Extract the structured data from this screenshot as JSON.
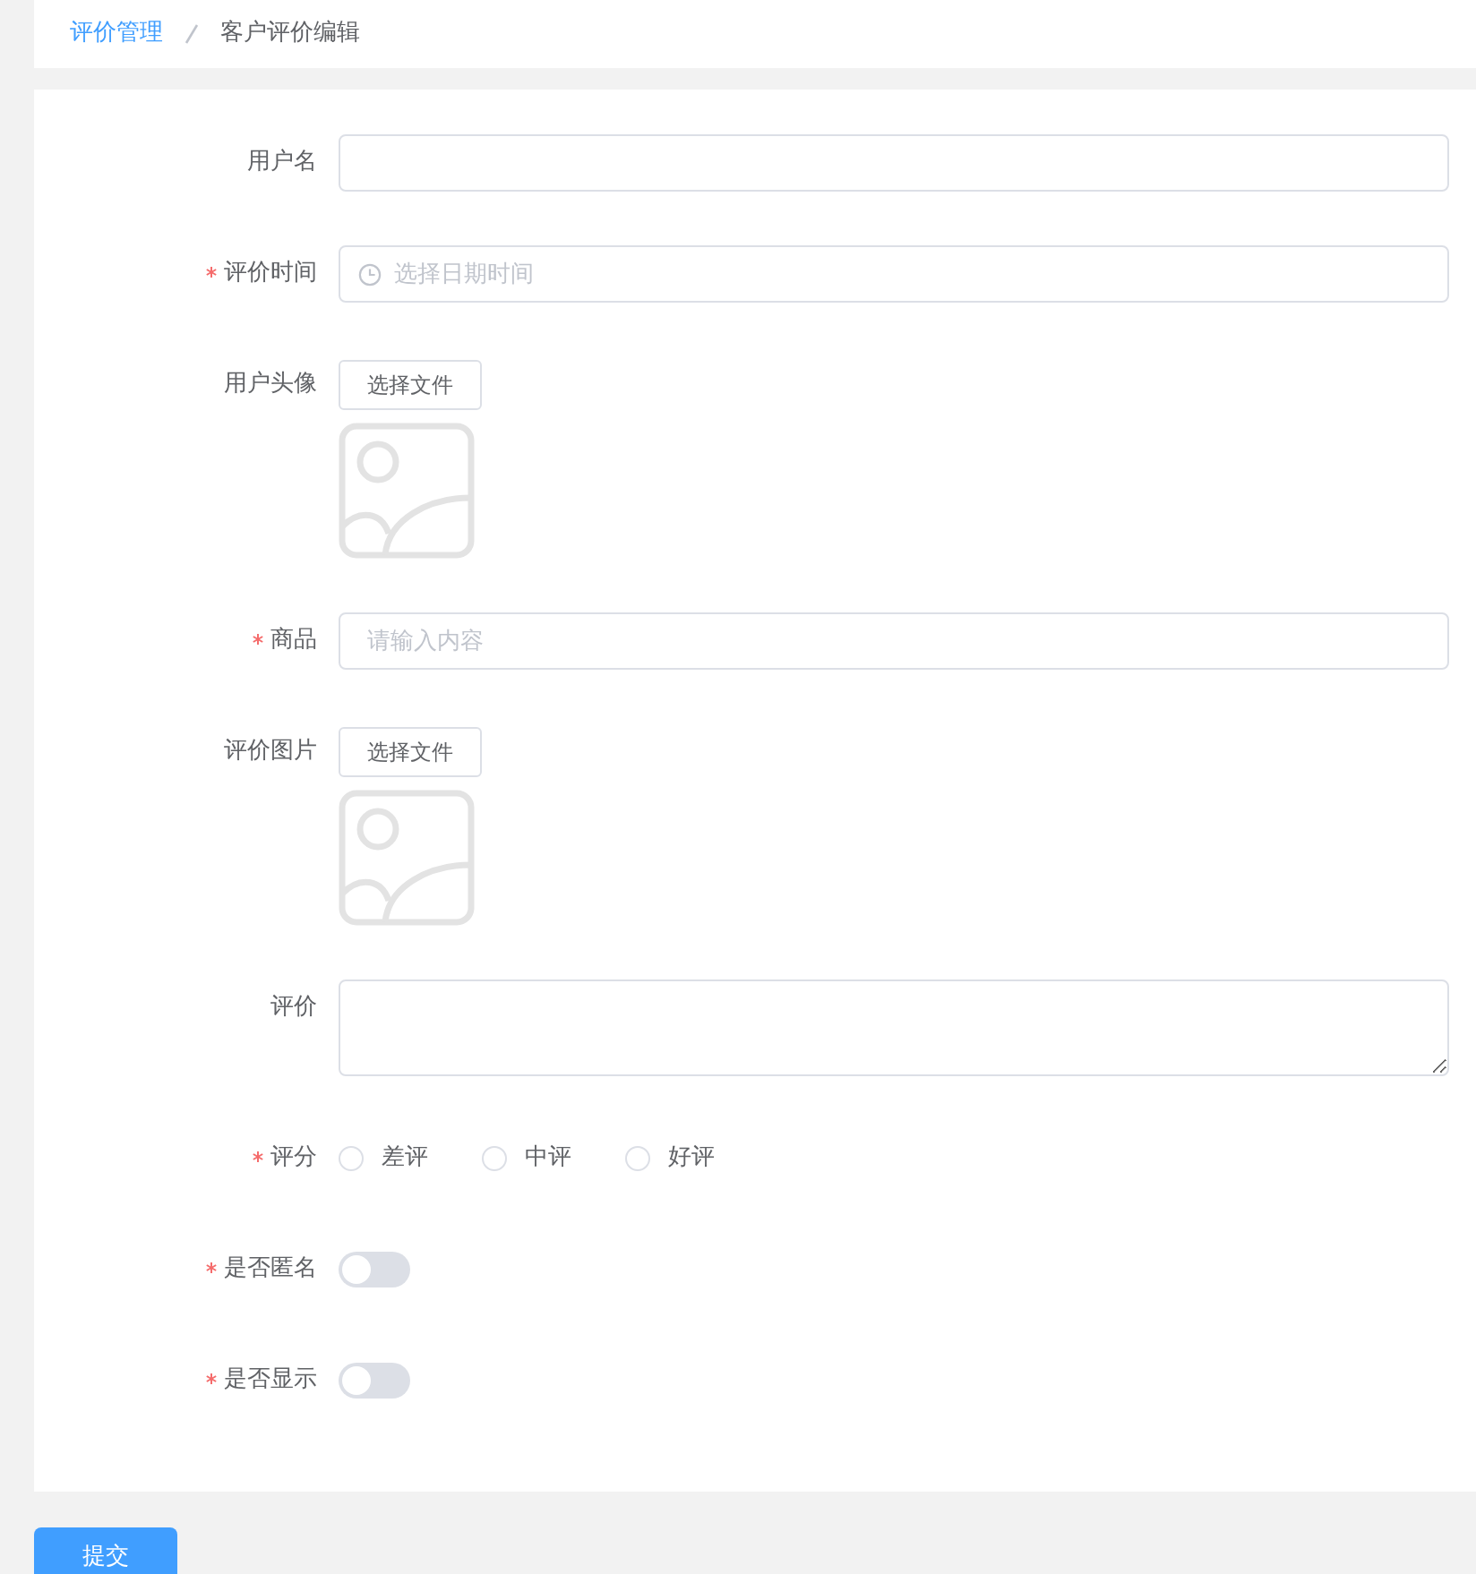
{
  "breadcrumb": [
    {
      "label": "评价管理",
      "kind": "link"
    },
    {
      "label": "客户评价编辑",
      "kind": "current"
    }
  ],
  "form": {
    "fields": [
      {
        "kind": "text",
        "label": "用户名",
        "required": false
      },
      {
        "kind": "datetime",
        "label": "评价时间",
        "required": true,
        "placeholder": "选择日期时间"
      },
      {
        "kind": "file",
        "label": "用户头像",
        "required": false,
        "button": "选择文件"
      },
      {
        "kind": "text",
        "label": "商品",
        "required": true,
        "placeholder": "请输入内容"
      },
      {
        "kind": "file",
        "label": "评价图片",
        "required": false,
        "button": "选择文件"
      },
      {
        "kind": "textarea",
        "label": "评价",
        "required": false
      },
      {
        "kind": "radio",
        "label": "评分",
        "required": true,
        "options": [
          {
            "label": "差评",
            "selected": false
          },
          {
            "label": "中评",
            "selected": false
          },
          {
            "label": "好评",
            "selected": false
          }
        ]
      },
      {
        "kind": "switch",
        "label": "是否匿名",
        "required": true,
        "on": false
      },
      {
        "kind": "switch",
        "label": "是否显示",
        "required": true,
        "on": false
      }
    ]
  },
  "submit_button": "提交"
}
